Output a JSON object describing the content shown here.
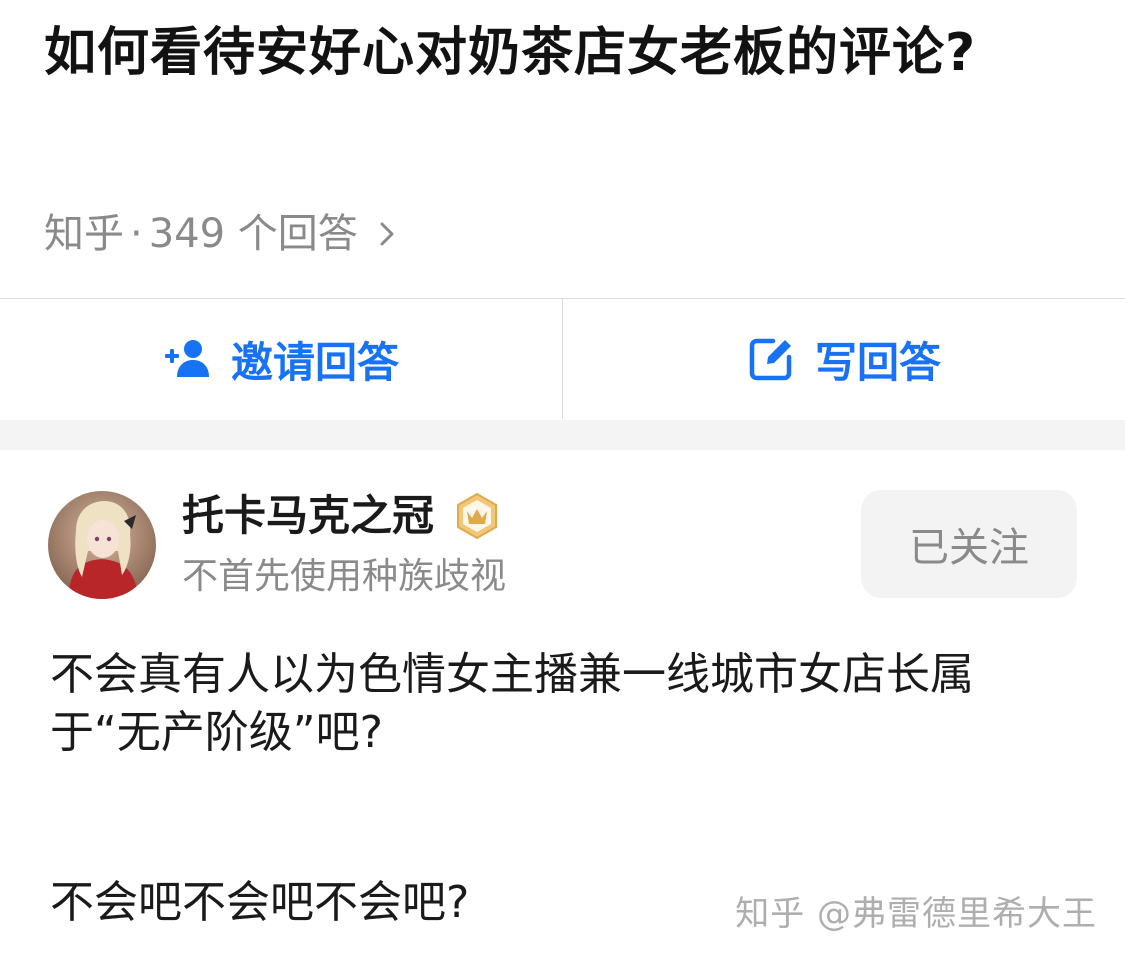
{
  "question": {
    "title": "如何看待安好心对奶茶店女老板的评论?",
    "source": "知乎",
    "separator": "·",
    "answer_count": "349 个回答"
  },
  "actions": {
    "invite_label": "邀请回答",
    "invite_icon": "add-user-icon",
    "write_label": "写回答",
    "write_icon": "edit-icon",
    "accent_color": "#1772f6"
  },
  "answer": {
    "author_name": "托卡马克之冠",
    "author_bio": "不首先使用种族歧视",
    "badge_icon": "crown-badge-icon",
    "follow_label": "已关注",
    "paragraphs": [
      "不会真有人以为色情女主播兼一线城市女店长属于“无产阶级”吧?",
      "不会吧不会吧不会吧?"
    ],
    "watermark": "知乎 @弗雷德里希大王"
  }
}
